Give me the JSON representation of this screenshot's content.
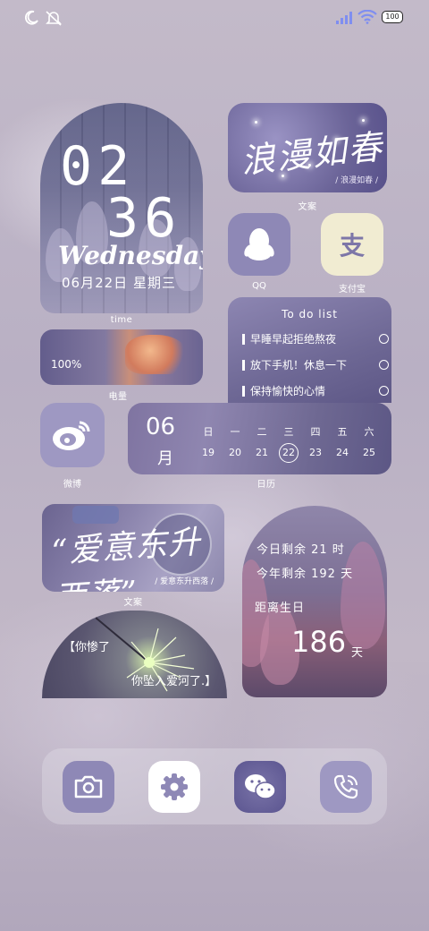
{
  "status_bar": {
    "battery": "100"
  },
  "clock_widget": {
    "hour": "02",
    "minute": "36",
    "weekday": "Wednesday",
    "date": "06月22日  星期三",
    "label": "time"
  },
  "text_widget_1": {
    "title": "浪漫如春",
    "caption": "/ 浪漫如春 /",
    "label": "文案"
  },
  "apps": [
    {
      "name": "QQ",
      "icon": "qq-penguin-icon"
    },
    {
      "name": "支付宝",
      "icon": "alipay-icon",
      "glyph": "支"
    }
  ],
  "battery_widget": {
    "percent": "100%",
    "label": "电量"
  },
  "todo_widget": {
    "title": "To do list",
    "items": [
      "早睡早起拒绝熬夜",
      "放下手机！休息一下",
      "保持愉快的心情"
    ]
  },
  "calendar_widget": {
    "month_num": "06",
    "month_char": "月",
    "weekdays": [
      "日",
      "一",
      "二",
      "三",
      "四",
      "五",
      "六"
    ],
    "days": [
      "19",
      "20",
      "21",
      "22",
      "23",
      "24",
      "25"
    ],
    "today": "22",
    "label": "日历"
  },
  "weibo": {
    "name": "微博",
    "icon": "weibo-icon"
  },
  "text_widget_2": {
    "title": "“爱意东升西落”",
    "caption": "/ 爱意东升西落 /",
    "label": "文案"
  },
  "firework_widget": {
    "line1": "【你惨了",
    "line2": "你坠入爱河了.】"
  },
  "countdown_widget": {
    "today_left": "今日剩余  21  时",
    "year_left": "今年剩余  192  天",
    "birthday_label": "距离生日",
    "birthday_days": "186",
    "birthday_unit": "天"
  },
  "dock": [
    {
      "name": "camera",
      "icon": "camera-icon"
    },
    {
      "name": "settings",
      "icon": "gear-icon"
    },
    {
      "name": "wechat",
      "icon": "wechat-icon"
    },
    {
      "name": "phone",
      "icon": "phone-icon"
    }
  ],
  "colors": {
    "accent": "#8e88b6",
    "icon_bg": "#9e98c2",
    "alipay_bg": "#f1ecd2"
  }
}
